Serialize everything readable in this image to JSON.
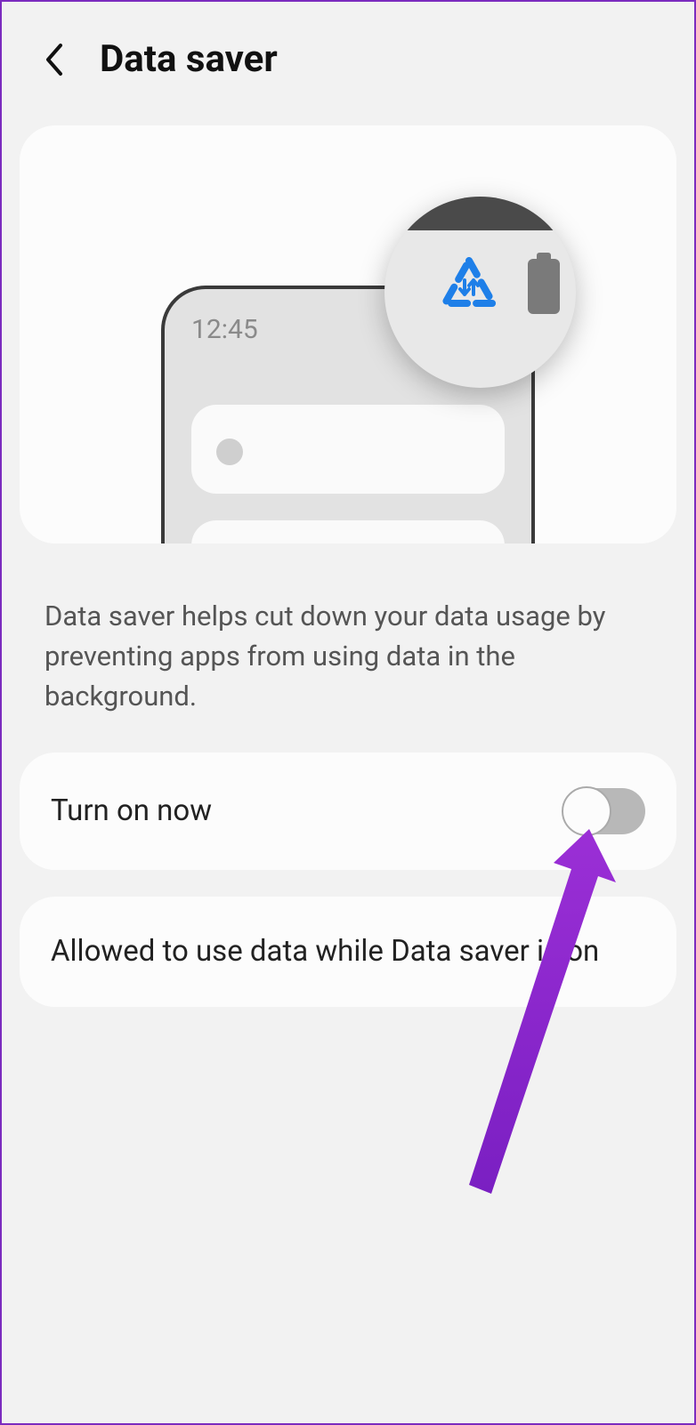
{
  "header": {
    "title": "Data saver"
  },
  "illustration": {
    "time": "12:45"
  },
  "description": "Data saver helps cut down your data usage by preventing apps from using data in the background.",
  "rows": {
    "toggle_label": "Turn on now",
    "allowed_label": "Allowed to use data while Data saver is on"
  }
}
